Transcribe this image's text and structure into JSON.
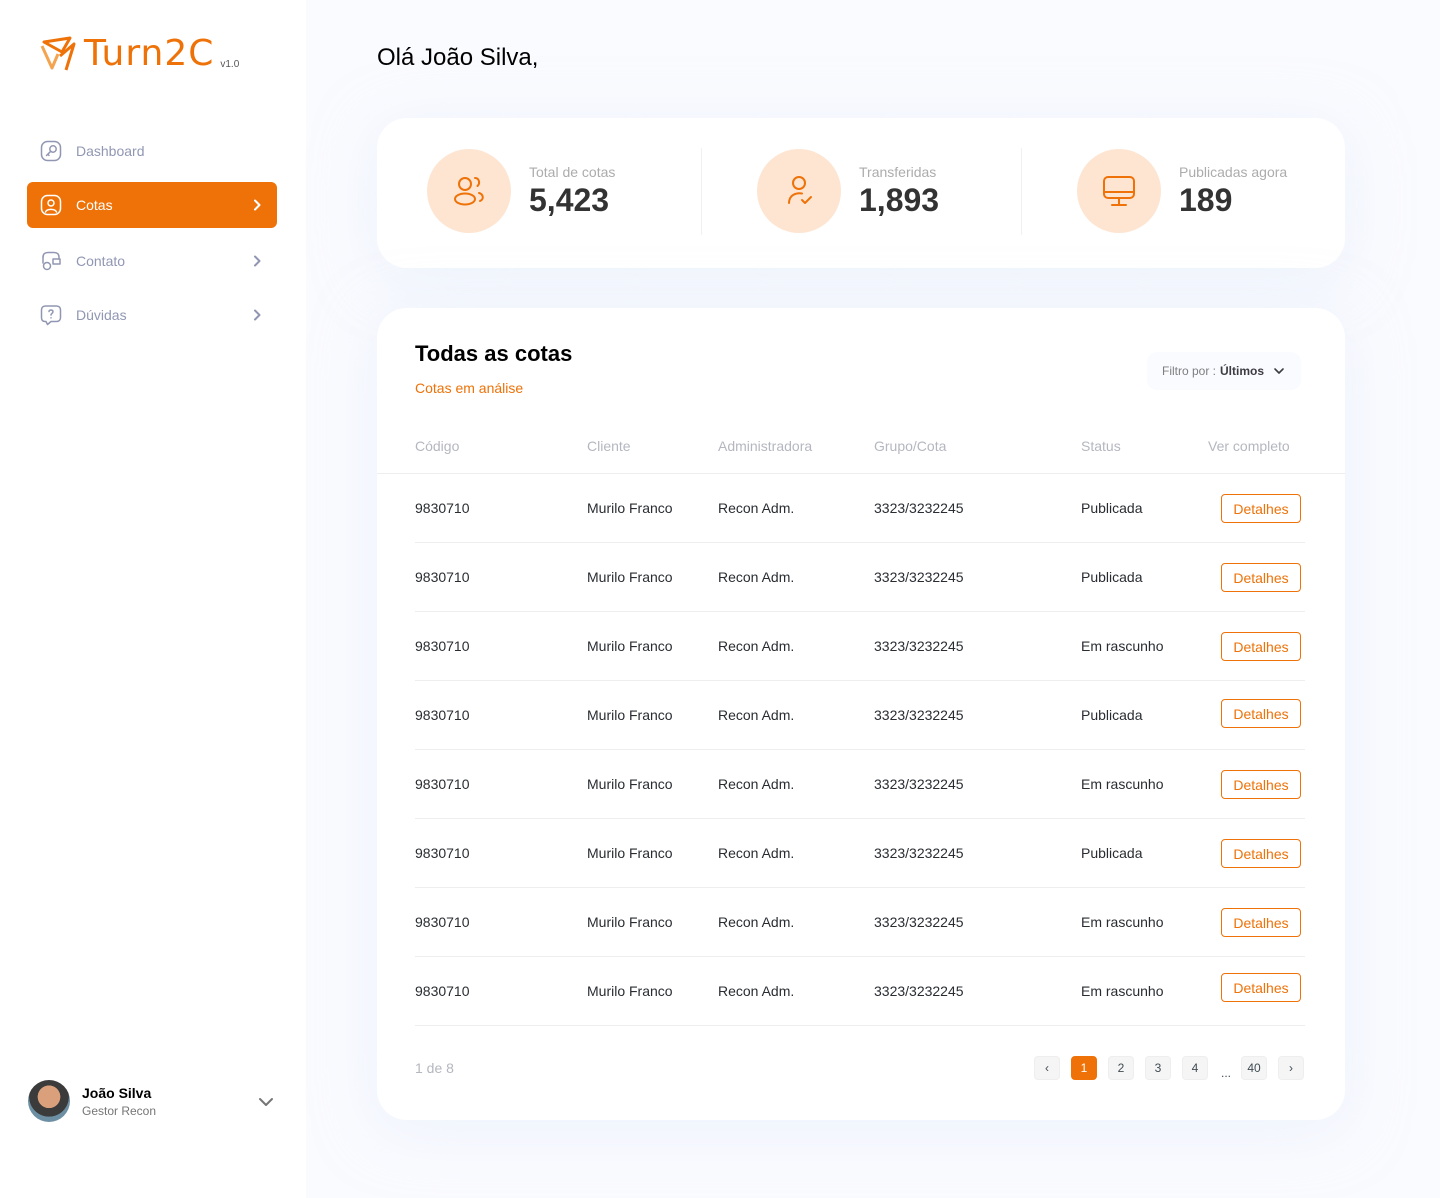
{
  "brand": {
    "name": "Turn2C",
    "version": "v1.0",
    "accent": "#ee7208"
  },
  "sidebar": {
    "items": [
      {
        "label": "Dashboard",
        "icon": "key-square-icon"
      },
      {
        "label": "Cotas",
        "icon": "user-square-icon",
        "active": true
      },
      {
        "label": "Contato",
        "icon": "wallet-money-icon"
      },
      {
        "label": "Dúvidas",
        "icon": "message-question-icon"
      }
    ]
  },
  "user": {
    "name": "João Silva",
    "role": "Gestor Recon"
  },
  "greeting": "Olá João Silva,",
  "stats": [
    {
      "label": "Total de cotas",
      "value": "5,423",
      "icon": "users-icon"
    },
    {
      "label": "Transferidas",
      "value": "1,893",
      "icon": "user-check-icon"
    },
    {
      "label": "Publicadas agora",
      "value": "189",
      "icon": "monitor-icon"
    }
  ],
  "table": {
    "title": "Todas as cotas",
    "subtitle": "Cotas em análise",
    "filter": {
      "prefix": "Filtro por :",
      "value": "Últimos"
    },
    "columns": [
      "Código",
      "Cliente",
      "Administradora",
      "Grupo/Cota",
      "Status",
      "Ver completo"
    ],
    "rows": [
      {
        "codigo": "9830710",
        "cliente": "Murilo Franco",
        "adm": "Recon Adm.",
        "grupo": "3323/3232245",
        "status": "Publicada",
        "action": "Detalhes"
      },
      {
        "codigo": "9830710",
        "cliente": "Murilo Franco",
        "adm": "Recon Adm.",
        "grupo": "3323/3232245",
        "status": "Publicada",
        "action": "Detalhes"
      },
      {
        "codigo": "9830710",
        "cliente": "Murilo Franco",
        "adm": "Recon Adm.",
        "grupo": "3323/3232245",
        "status": "Em rascunho",
        "action": "Detalhes"
      },
      {
        "codigo": "9830710",
        "cliente": "Murilo Franco",
        "adm": "Recon Adm.",
        "grupo": "3323/3232245",
        "status": "Publicada",
        "action": "Detalhes"
      },
      {
        "codigo": "9830710",
        "cliente": "Murilo Franco",
        "adm": "Recon Adm.",
        "grupo": "3323/3232245",
        "status": "Em rascunho",
        "action": "Detalhes"
      },
      {
        "codigo": "9830710",
        "cliente": "Murilo Franco",
        "adm": "Recon Adm.",
        "grupo": "3323/3232245",
        "status": "Publicada",
        "action": "Detalhes"
      },
      {
        "codigo": "9830710",
        "cliente": "Murilo Franco",
        "adm": "Recon Adm.",
        "grupo": "3323/3232245",
        "status": "Em rascunho",
        "action": "Detalhes"
      },
      {
        "codigo": "9830710",
        "cliente": "Murilo Franco",
        "adm": "Recon Adm.",
        "grupo": "3323/3232245",
        "status": "Em rascunho",
        "action": "Detalhes"
      }
    ]
  },
  "pagination": {
    "info": "1 de 8",
    "prev": "‹",
    "next": "›",
    "pages": [
      "1",
      "2",
      "3",
      "4"
    ],
    "ellipsis": "...",
    "last": "40",
    "current": "1"
  }
}
